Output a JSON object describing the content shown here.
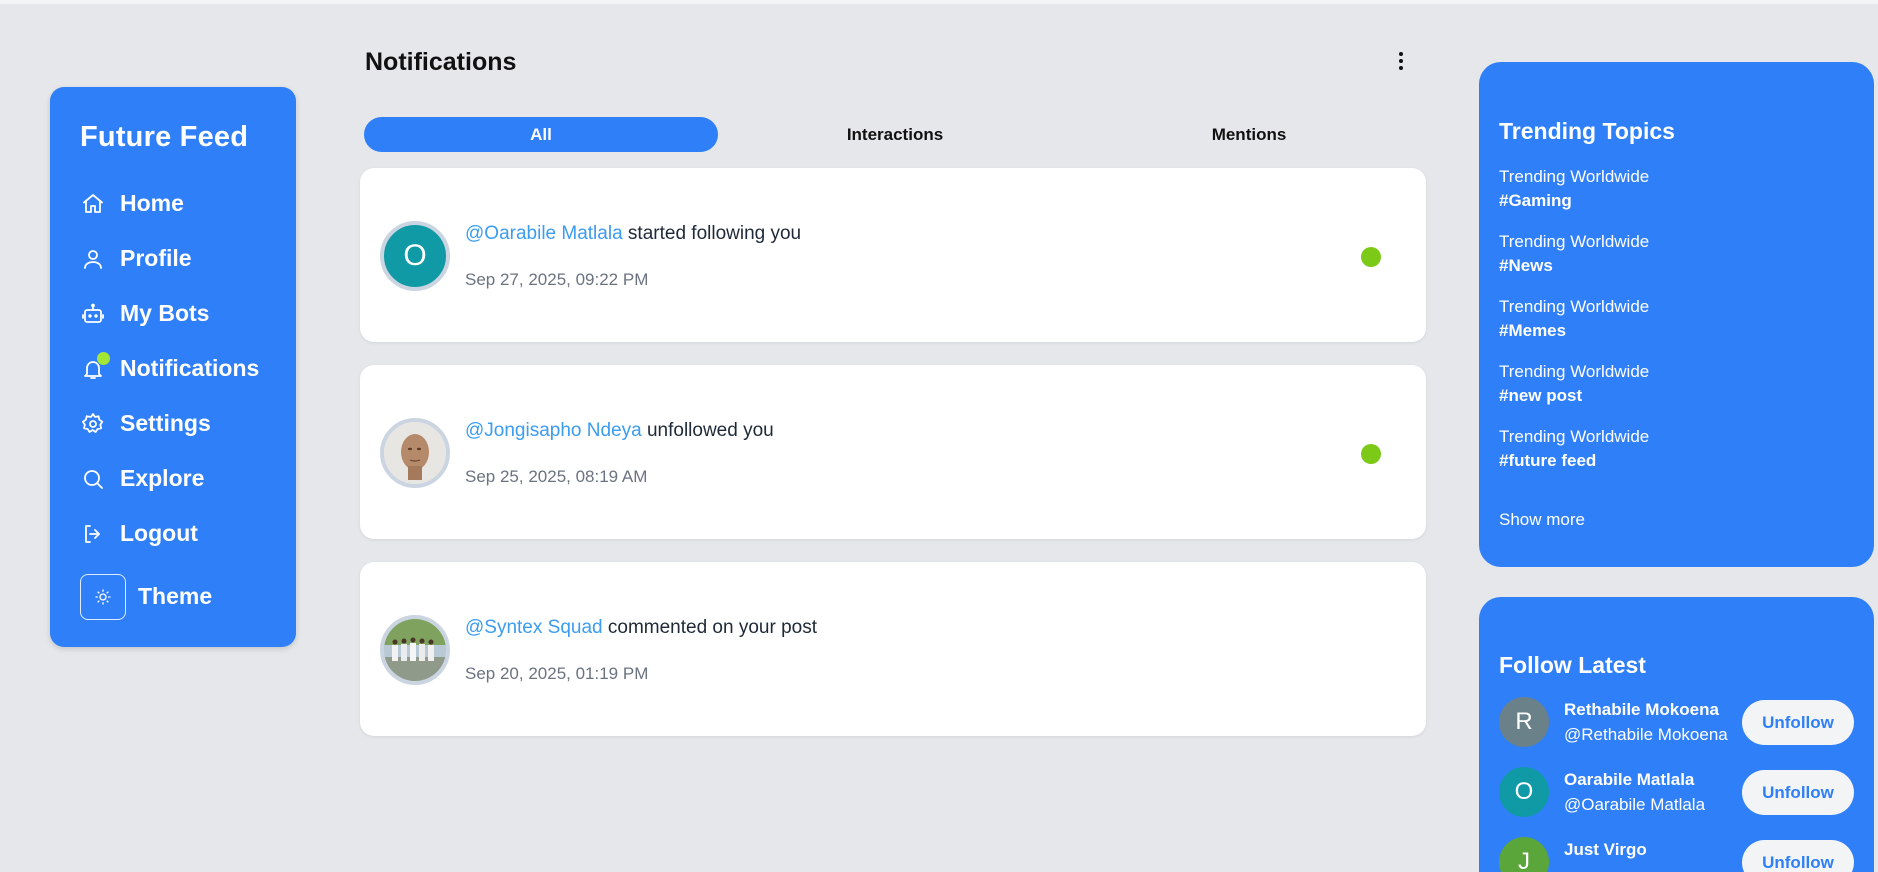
{
  "app": {
    "brand": "Future Feed"
  },
  "sidebar": {
    "items": [
      {
        "label": "Home",
        "icon": "home-icon"
      },
      {
        "label": "Profile",
        "icon": "user-icon"
      },
      {
        "label": "My Bots",
        "icon": "bot-icon"
      },
      {
        "label": "Notifications",
        "icon": "bell-icon",
        "has_dot": true
      },
      {
        "label": "Settings",
        "icon": "gear-icon"
      },
      {
        "label": "Explore",
        "icon": "search-icon"
      },
      {
        "label": "Logout",
        "icon": "logout-icon"
      }
    ],
    "theme_label": "Theme"
  },
  "main": {
    "title": "Notifications",
    "tabs": [
      {
        "label": "All",
        "active": true
      },
      {
        "label": "Interactions",
        "active": false
      },
      {
        "label": "Mentions",
        "active": false
      }
    ],
    "notifications": [
      {
        "user": "@Oarabile Matlala",
        "action": " started following you",
        "time": "Sep 27, 2025, 09:22 PM",
        "avatar_letter": "O",
        "unread": true
      },
      {
        "user": "@Jongisapho Ndeya",
        "action": " unfollowed you",
        "time": "Sep 25, 2025, 08:19 AM",
        "avatar_letter": "",
        "unread": true
      },
      {
        "user": "@Syntex Squad",
        "action": " commented on your post",
        "time": "Sep 20, 2025, 01:19 PM",
        "avatar_letter": "",
        "unread": false
      }
    ]
  },
  "trending": {
    "title": "Trending Topics",
    "items": [
      {
        "subtitle": "Trending Worldwide",
        "tag": "#Gaming"
      },
      {
        "subtitle": "Trending Worldwide",
        "tag": "#News"
      },
      {
        "subtitle": "Trending Worldwide",
        "tag": "#Memes"
      },
      {
        "subtitle": "Trending Worldwide",
        "tag": "#new post"
      },
      {
        "subtitle": "Trending Worldwide",
        "tag": "#future feed"
      }
    ],
    "show_more": "Show more"
  },
  "follow_latest": {
    "title": "Follow Latest",
    "users": [
      {
        "name": "Rethabile Mokoena",
        "handle": "@Rethabile Mokoena",
        "letter": "R",
        "color": "#6b8189",
        "button": "Unfollow"
      },
      {
        "name": "Oarabile Matlala",
        "handle": "@Oarabile Matlala",
        "letter": "O",
        "color": "#0f9aa6",
        "button": "Unfollow"
      },
      {
        "name": "Just Virgo",
        "handle": "",
        "letter": "J",
        "color": "#5aa63a",
        "button": "Unfollow"
      }
    ]
  },
  "colors": {
    "accent": "#2f7ff8",
    "background": "#e5e7eb",
    "unread_dot": "#7cc918",
    "notification_badge": "#a3e635",
    "mention": "#3b9cf0"
  }
}
